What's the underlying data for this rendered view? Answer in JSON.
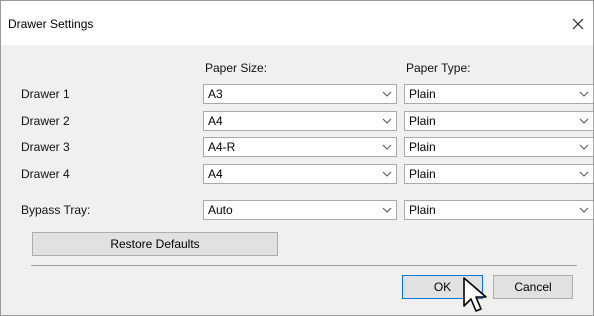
{
  "window": {
    "title": "Drawer Settings",
    "close_glyph": "✕"
  },
  "headers": {
    "paper_size": "Paper Size:",
    "paper_type": "Paper Type:"
  },
  "rows": [
    {
      "label": "Drawer 1",
      "paper_size": "A3",
      "paper_type": "Plain"
    },
    {
      "label": "Drawer 2",
      "paper_size": "A4",
      "paper_type": "Plain"
    },
    {
      "label": "Drawer 3",
      "paper_size": "A4-R",
      "paper_type": "Plain"
    },
    {
      "label": "Drawer 4",
      "paper_size": "A4",
      "paper_type": "Plain"
    },
    {
      "label": "Bypass Tray:",
      "paper_size": "Auto",
      "paper_type": "Plain"
    }
  ],
  "buttons": {
    "restore_defaults": "Restore Defaults",
    "ok": "OK",
    "cancel": "Cancel"
  },
  "icons": {
    "combo_arrow": "chevron-down-icon",
    "close": "close-icon",
    "pointer": "mouse-pointer-icon"
  },
  "colors": {
    "dialog_bg": "#f0f0f0",
    "focus_border": "#0078d7"
  }
}
